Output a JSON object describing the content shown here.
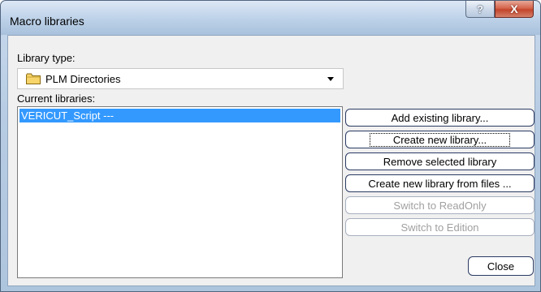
{
  "window": {
    "title": "Macro libraries",
    "help_label": "?",
    "close_label": "X"
  },
  "library_type": {
    "label": "Library type:",
    "selected": "PLM Directories",
    "icon": "folder-icon"
  },
  "current_libraries": {
    "label": "Current libraries:",
    "items": [
      {
        "label": "VERICUT_Script   ---",
        "selected": true
      }
    ]
  },
  "buttons": {
    "add_existing": "Add existing library...",
    "create_new": "Create new library...",
    "remove_selected": "Remove selected library",
    "create_from_files": "Create new library from files ...",
    "switch_readonly": "Switch to ReadOnly",
    "switch_edition": "Switch to Edition",
    "close": "Close"
  },
  "colors": {
    "selection": "#3399ff",
    "close_button": "#c2452b"
  }
}
